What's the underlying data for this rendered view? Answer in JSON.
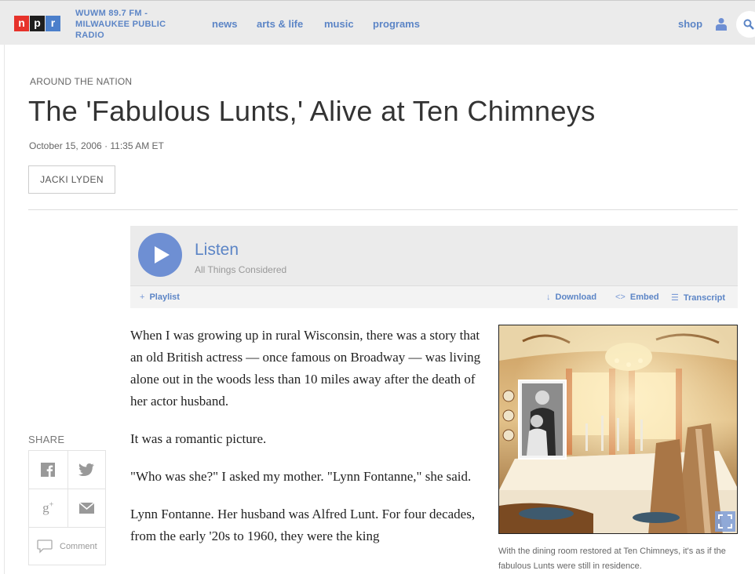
{
  "header": {
    "logo": [
      "n",
      "p",
      "r"
    ],
    "station": "WUWM 89.7 FM - MILWAUKEE PUBLIC RADIO",
    "nav": [
      "news",
      "arts & life",
      "music",
      "programs"
    ],
    "shop": "shop",
    "icons": {
      "user": "user-icon",
      "search": "search-icon"
    },
    "accent": "#5c85c6"
  },
  "article": {
    "slug": "AROUND THE NATION",
    "title": "The 'Fabulous Lunts,' Alive at Ten Chimneys",
    "dateline": "October 15, 2006 · 11:35 AM ET",
    "byline": "JACKI LYDEN"
  },
  "player": {
    "listen": "Listen",
    "program": "All Things Considered",
    "playlist": "Playlist",
    "download": "Download",
    "embed": "Embed",
    "transcript": "Transcript",
    "icons": {
      "play": "play-icon",
      "playlist": "plus-icon",
      "download": "download-arrow-icon",
      "embed": "code-icon",
      "transcript": "list-icon"
    }
  },
  "story": {
    "paragraphs": [
      "When I was growing up in rural Wisconsin, there was a story that an old British actress — once famous on Broadway — was living alone out in the woods less than 10 miles away after the death of her actor husband.",
      "It was a romantic picture.",
      "\"Who was she?\" I asked my mother. \"Lynn Fontanne,\" she said.",
      "Lynn Fontanne. Her husband was Alfred Lunt. For four decades, from the early '20s to 1960, they were the king"
    ]
  },
  "share": {
    "label": "SHARE",
    "comment": "Comment",
    "icons": [
      "facebook-icon",
      "twitter-icon",
      "google-plus-icon",
      "email-icon",
      "comment-icon"
    ]
  },
  "photo": {
    "caption": "With the dining room restored at Ten Chimneys, it's as if the fabulous Lunts were still in residence.",
    "icon": "expand-icon"
  }
}
